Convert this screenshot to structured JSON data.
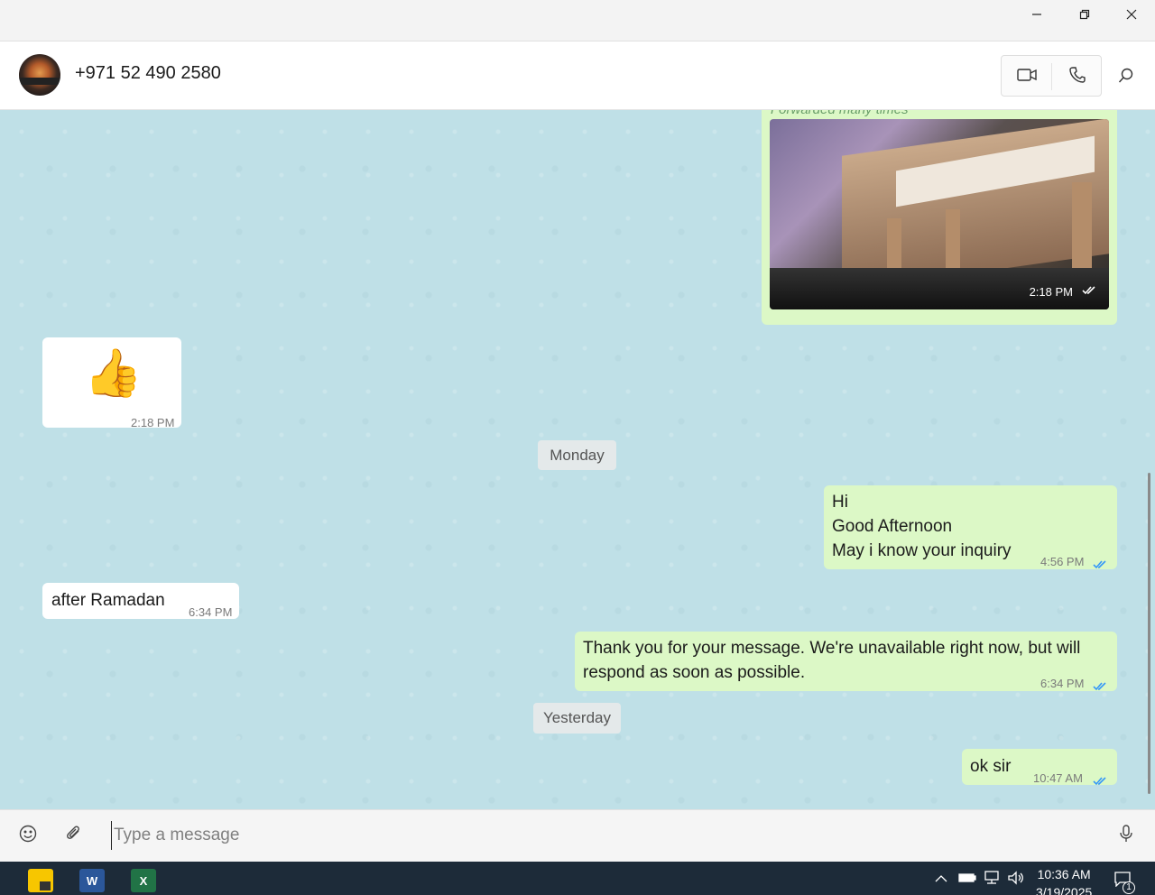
{
  "window": {
    "minimize_icon": "minimize-icon",
    "restore_icon": "restore-icon",
    "close_icon": "close-icon"
  },
  "header": {
    "contact_name": "+971 52 490 2580",
    "video_icon": "video-camera-icon",
    "call_icon": "phone-icon",
    "search_icon": "search-icon"
  },
  "messages": {
    "photo": {
      "forward_label": "Forwarded many times",
      "time": "2:18 PM",
      "status": "read"
    },
    "thumbs": {
      "emoji": "👍",
      "time": "2:18 PM"
    },
    "date_monday": "Monday",
    "greeting": {
      "line1": "Hi",
      "line2": "Good Afternoon",
      "line3": "May i know your inquiry",
      "time": "4:56 PM",
      "status": "read"
    },
    "after_ramadan": {
      "text": "after Ramadan",
      "time": "6:34 PM"
    },
    "auto_reply": {
      "line1": "Thank you for your message. We're unavailable right now, but will",
      "line2": "respond as soon as possible.",
      "time": "6:34 PM",
      "status": "read"
    },
    "date_yesterday": "Yesterday",
    "ok_sir": {
      "text": "ok sir",
      "time": "10:47 AM",
      "status": "read"
    }
  },
  "composer": {
    "placeholder": "Type a message",
    "emoji_icon": "emoji-icon",
    "attach_icon": "paperclip-icon",
    "mic_icon": "microphone-icon"
  },
  "taskbar": {
    "apps": [
      {
        "name": "Sticky Notes",
        "color": "#f7c600"
      },
      {
        "name": "Word",
        "glyph": "W",
        "color": "#2b579a"
      },
      {
        "name": "Excel",
        "glyph": "X",
        "color": "#217346"
      }
    ],
    "clock_time": "10:36 AM",
    "clock_date": "3/19/2025",
    "notification_count": "1"
  },
  "colors": {
    "chat_bg": "#bfe0e7",
    "outgoing_bubble": "#dcf8c6",
    "incoming_bubble": "#ffffff",
    "read_ticks": "#3497f9",
    "taskbar": "#1d2b39"
  }
}
